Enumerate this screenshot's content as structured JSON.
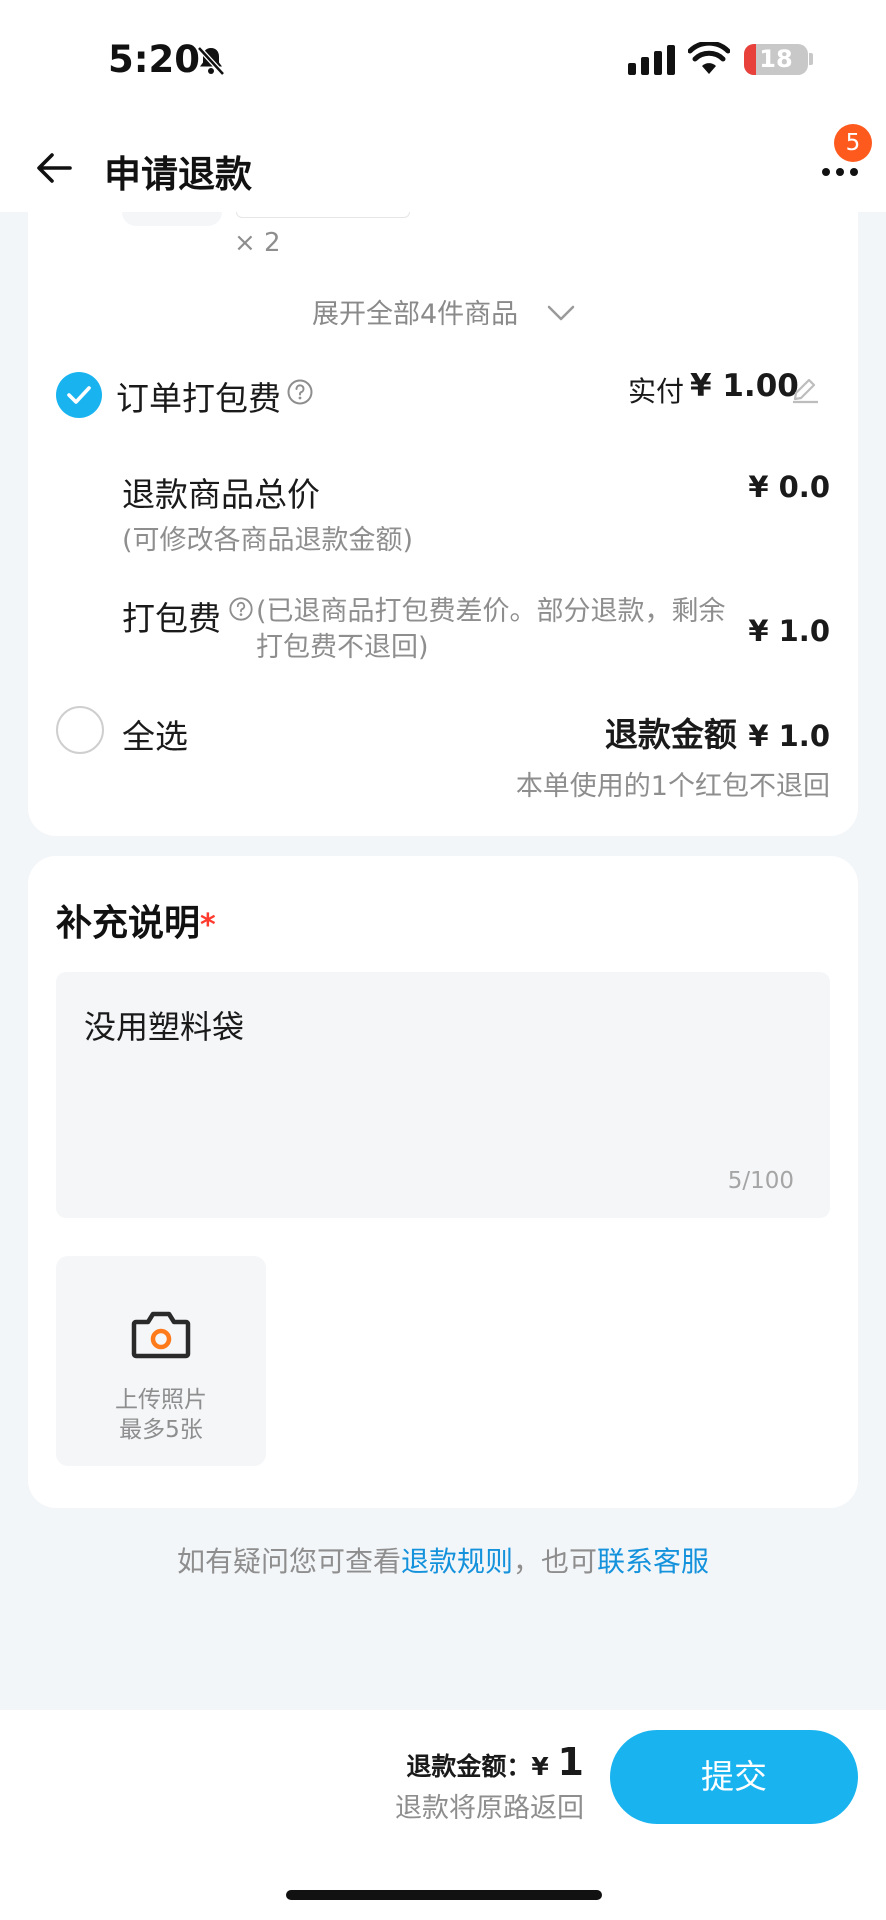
{
  "status_bar": {
    "time": "5:20",
    "battery": "18",
    "battery_level_percent": 18
  },
  "header": {
    "title": "申请退款",
    "notification_count": "5"
  },
  "order": {
    "item_qty": "× 2",
    "expand_label": "展开全部4件商品",
    "packing_fee_label": "订单打包费",
    "paid_label": "实付",
    "paid_value": "¥ 1.00",
    "packing_fee_checked": true,
    "goods_total_label": "退款商品总价",
    "goods_total_sub": "(可修改各商品退款金额)",
    "goods_total_value": "¥ 0.0",
    "fee_label": "打包费",
    "fee_note": "(已退商品打包费差价。部分退款，剩余打包费不退回)",
    "fee_value": "¥ 1.0",
    "select_all_label": "全选",
    "select_all_checked": false,
    "refund_label": "退款金额",
    "refund_value": "¥ 1.0",
    "redpack_note": "本单使用的1个红包不退回"
  },
  "supplement": {
    "title": "补充说明",
    "required_mark": "*",
    "text": "没用塑料袋",
    "count": "5/100",
    "upload_line1": "上传照片",
    "upload_line2": "最多5张"
  },
  "help": {
    "prefix": "如有疑问您可查看",
    "rules_link": "退款规则",
    "middle": "，也可",
    "service_link": "联系客服"
  },
  "footer": {
    "amount_label": "退款金额：",
    "currency": "¥",
    "amount_value": "1",
    "note": "退款将原路返回",
    "submit_label": "提交"
  },
  "colors": {
    "accent": "#19b4f0",
    "link": "#1592dc",
    "badge": "#ff5a1e",
    "required": "#ff3b30"
  }
}
